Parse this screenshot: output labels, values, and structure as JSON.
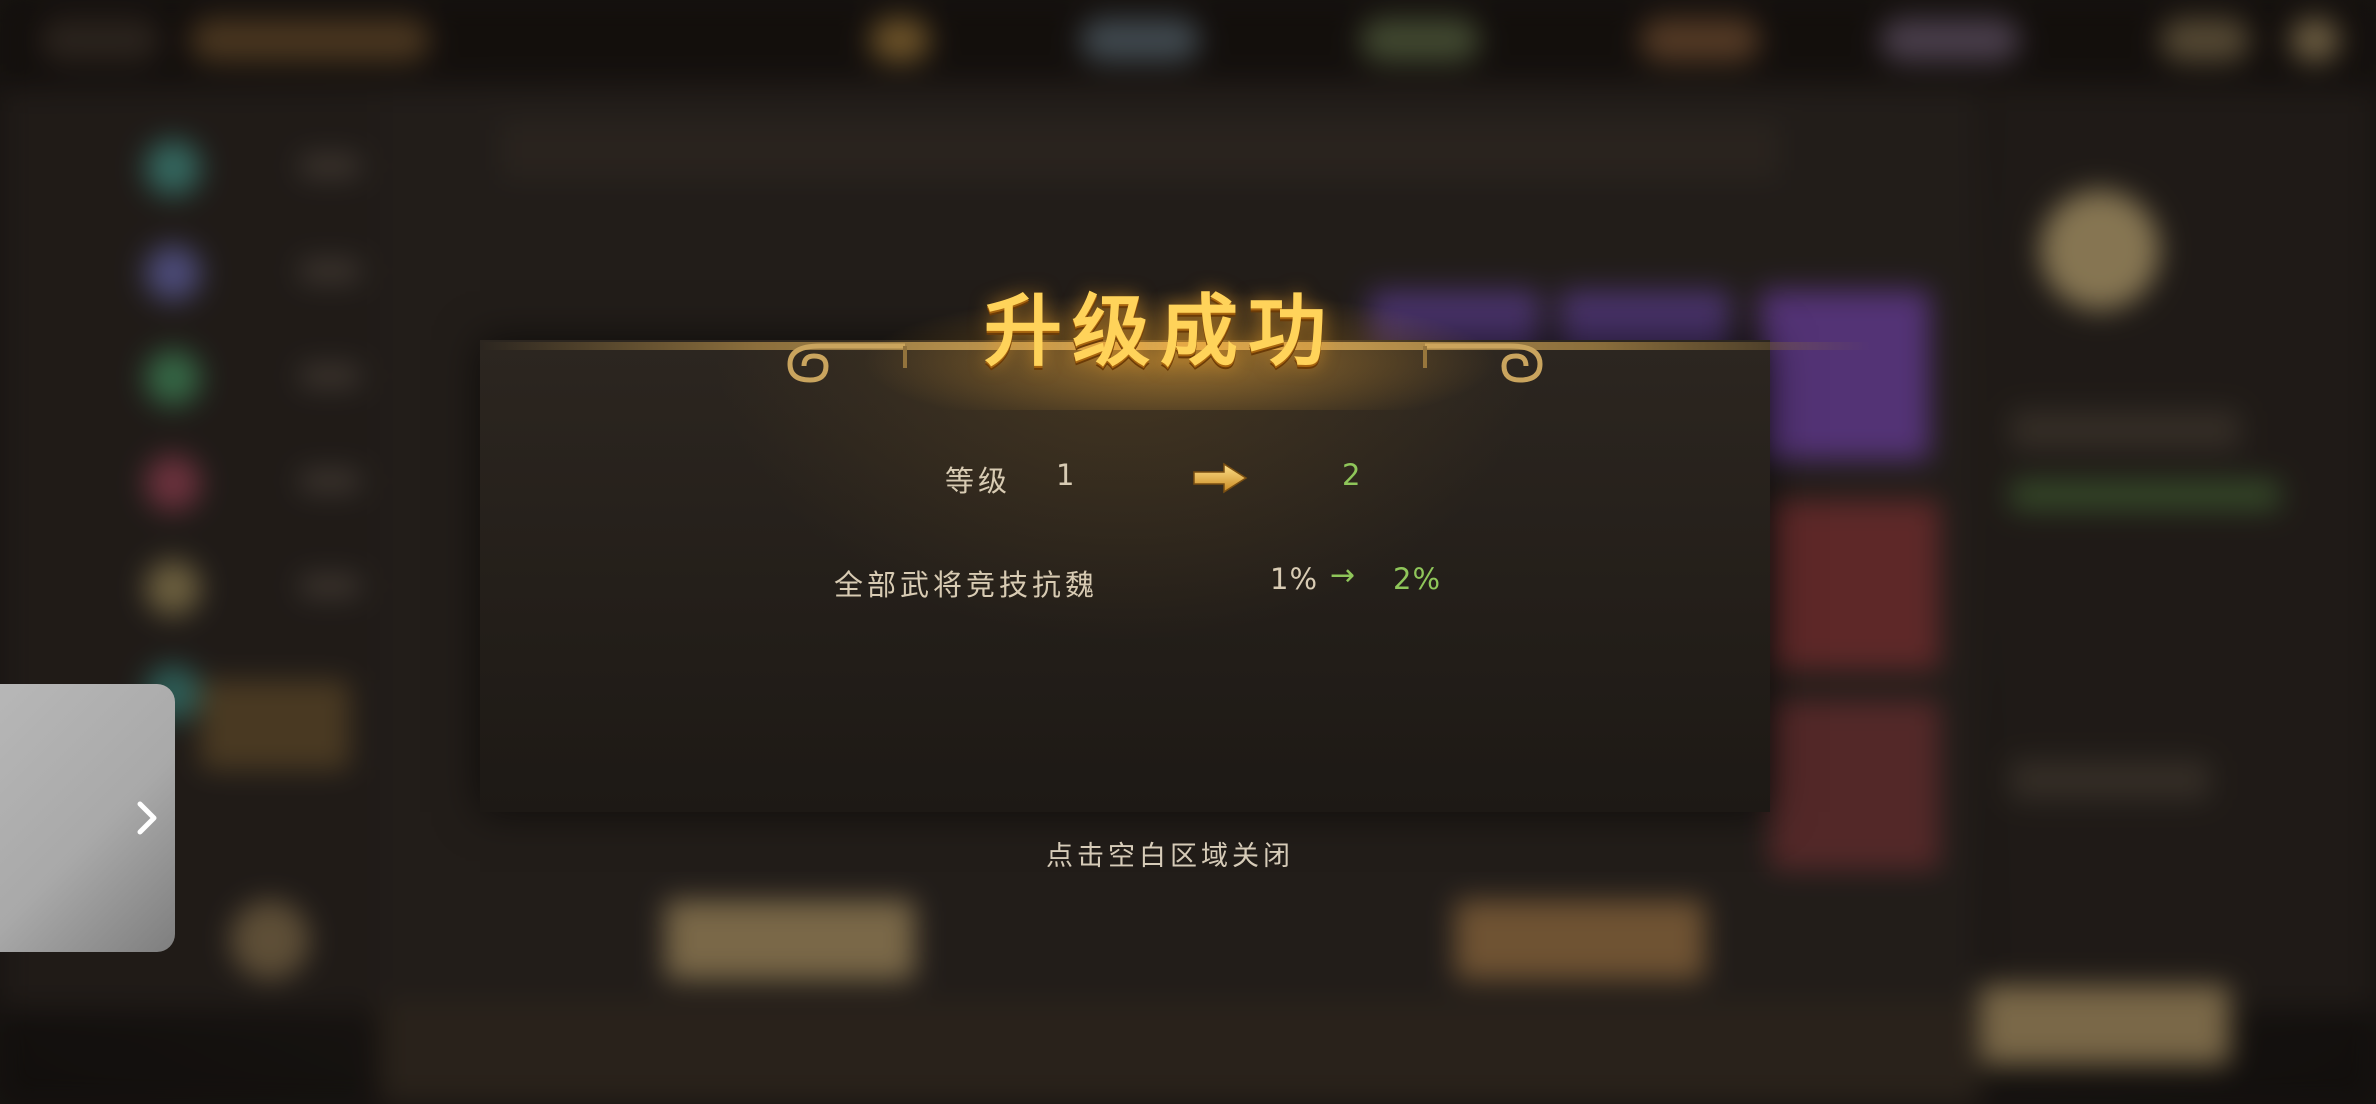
{
  "popup": {
    "title": "升级成功",
    "level_label": "等级",
    "level_from": "1",
    "level_to": "2",
    "bonus_label": "全部武将竞技抗魏",
    "bonus_from": "1%",
    "bonus_arrow": "→",
    "bonus_to": "2%",
    "close_hint": "点击空白区域关闭"
  },
  "colors": {
    "title_gold": "#ffd35a",
    "value_green": "#8fc65a",
    "text_light": "#d8cbb3"
  },
  "icons": {
    "level_arrow": "arrow-right-icon",
    "drawer": "chevron-right-icon"
  }
}
